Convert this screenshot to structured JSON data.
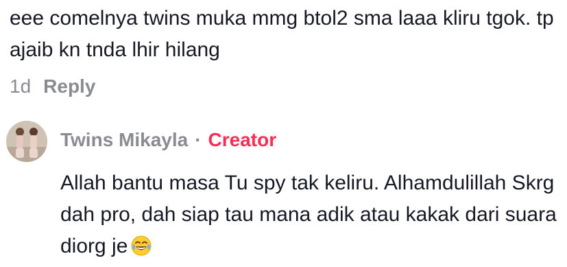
{
  "comment": {
    "text": "eee comelnya twins muka mmg btol2 sma laaa kliru tgok. tp ajaib kn tnda lhir hilang",
    "time": "1d",
    "reply_label": "Reply"
  },
  "reply": {
    "author": "Twins Mikayla",
    "separator": "·",
    "badge": "Creator",
    "text": "Allah bantu masa Tu spy tak keliru. Alhamdulillah Skrg dah pro, dah siap tau mana adik atau kakak dari suara diorg je",
    "emoji": "face-with-tears-of-joy-icon"
  },
  "colors": {
    "text": "#161823",
    "muted": "#8a8b91",
    "creator": "#fe2c55"
  }
}
